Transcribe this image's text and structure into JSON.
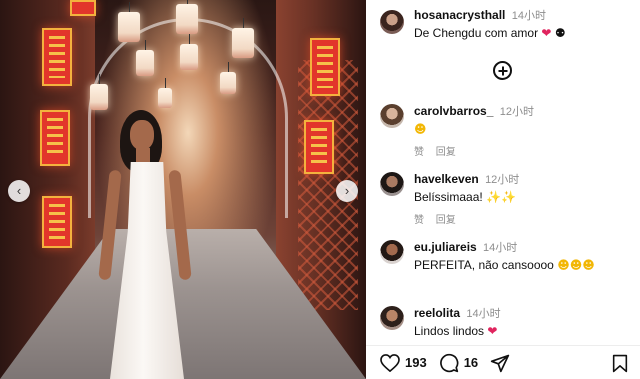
{
  "post": {
    "author": {
      "username": "hosanacrysthall",
      "time": "14小时",
      "caption": "De Chengdu com amor"
    }
  },
  "comments": [
    {
      "username": "carolvbarros_",
      "time": "12小时",
      "text": "",
      "reply_labels": [
        "赞",
        "回复"
      ]
    },
    {
      "username": "havelkeven",
      "time": "12小时",
      "text": "Belíssimaaa!",
      "reply_labels": [
        "赞",
        "回复"
      ]
    },
    {
      "username": "eu.juliareis",
      "time": "14小时",
      "text": "PERFEITA, não cansoooo",
      "reply_labels": []
    },
    {
      "username": "reelolita",
      "time": "14小时",
      "text": "Lindos lindos",
      "reply_labels": []
    }
  ],
  "actions": {
    "likes_count": "193",
    "comments_count": "16"
  },
  "icons": {
    "add_comment": "plus-circle-icon",
    "like": "heart-outline-icon",
    "comment": "speech-bubble-icon",
    "share": "paper-plane-icon",
    "save": "bookmark-icon",
    "carousel_prev": "chevron-left-icon",
    "carousel_next": "chevron-right-icon"
  },
  "colors": {
    "heart_red": "#e0245e",
    "muted_text": "#8e8e8e"
  }
}
